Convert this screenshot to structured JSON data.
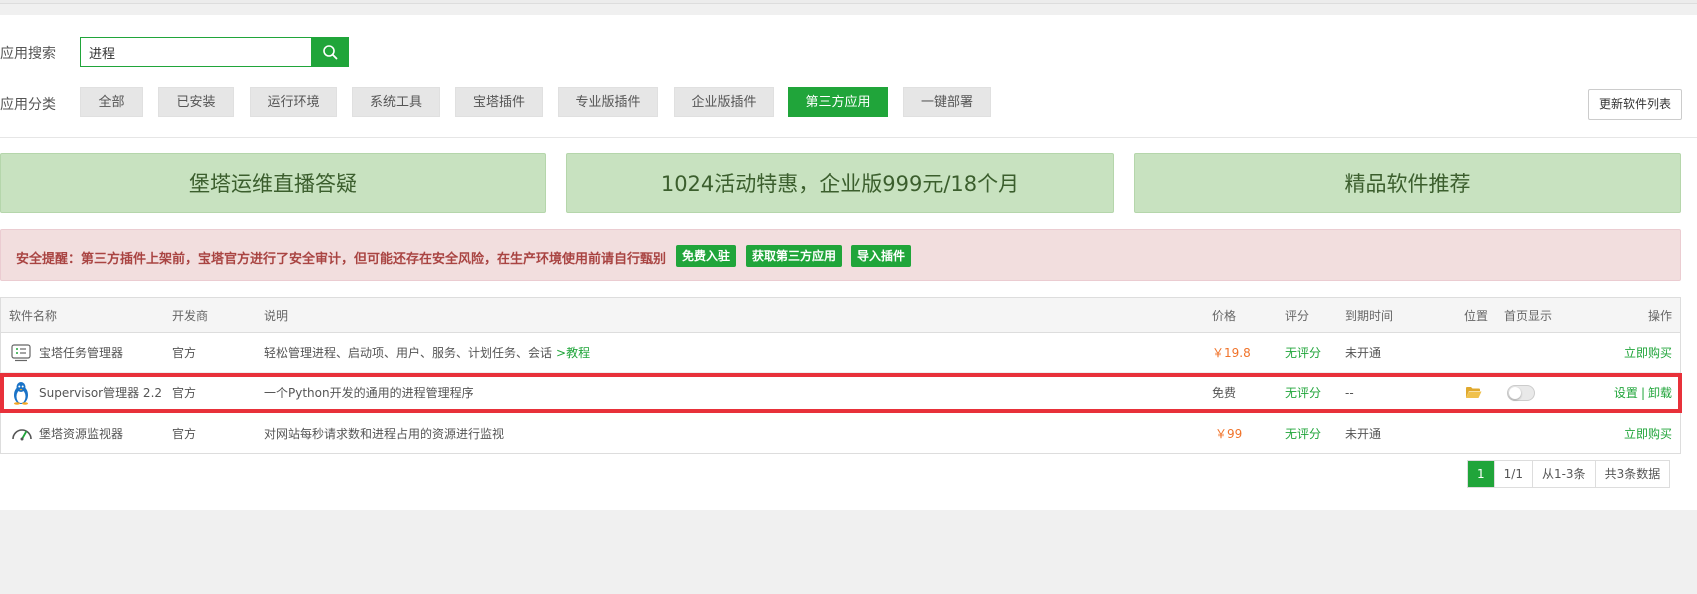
{
  "search": {
    "label": "应用搜索",
    "value": "进程"
  },
  "category": {
    "label": "应用分类",
    "items": [
      "全部",
      "已安装",
      "运行环境",
      "系统工具",
      "宝塔插件",
      "专业版插件",
      "企业版插件",
      "第三方应用",
      "一键部署"
    ],
    "active": "第三方应用"
  },
  "update_button": "更新软件列表",
  "banners": [
    "堡塔运维直播答疑",
    "1024活动特惠，企业版999元/18个月",
    "精品软件推荐"
  ],
  "alert": {
    "text": "安全提醒：第三方插件上架前，宝塔官方进行了安全审计，但可能还存在安全风险，在生产环境使用前请自行甄别",
    "buttons": [
      "免费入驻",
      "获取第三方应用",
      "导入插件"
    ]
  },
  "table": {
    "headers": [
      "软件名称",
      "开发商",
      "说明",
      "价格",
      "评分",
      "到期时间",
      "位置",
      "首页显示",
      "操作"
    ],
    "rows": [
      {
        "name": "宝塔任务管理器",
        "icon": "task-manager-icon",
        "developer": "官方",
        "desc": "轻松管理进程、启动项、用户、服务、计划任务、会话",
        "desc_link": ">教程",
        "price": "￥19.8",
        "rating": "无评分",
        "expiry": "未开通",
        "action": "立即购买"
      },
      {
        "name": "Supervisor管理器 2.2",
        "icon": "linux-penguin-icon",
        "developer": "官方",
        "desc": "一个Python开发的通用的进程管理程序",
        "price": "免费",
        "rating": "无评分",
        "expiry": "--",
        "action_settings": "设置",
        "action_sep": "|",
        "action_uninstall": "卸载"
      },
      {
        "name": "堡塔资源监视器",
        "icon": "gauge-icon",
        "developer": "官方",
        "desc": "对网站每秒请求数和进程占用的资源进行监视",
        "price": "￥99",
        "rating": "无评分",
        "expiry": "未开通",
        "action": "立即购买"
      }
    ]
  },
  "pagination": {
    "current": "1",
    "pages": "1/1",
    "range": "从1-3条",
    "total": "共3条数据"
  },
  "colors": {
    "accent": "#20a53a",
    "highlight": "#e8313a",
    "price": "#f0732a"
  }
}
